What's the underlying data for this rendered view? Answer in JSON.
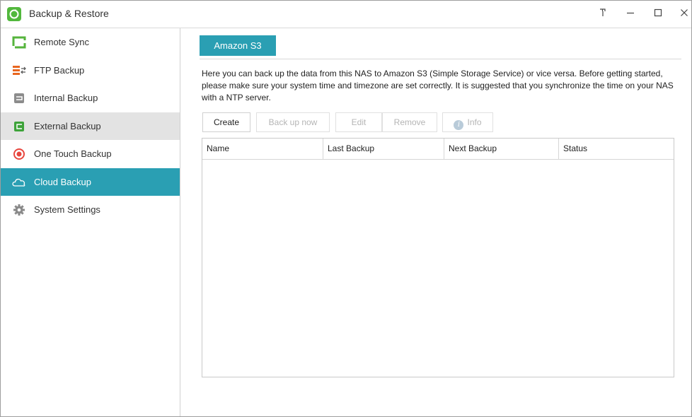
{
  "window": {
    "title": "Backup & Restore",
    "controls": {
      "pin": "ꟼ",
      "minimize": "—",
      "maximize": "☐",
      "close": "✕"
    }
  },
  "sidebar": {
    "items": [
      {
        "label": "Remote Sync",
        "icon": "remote-sync-icon"
      },
      {
        "label": "FTP Backup",
        "icon": "ftp-backup-icon"
      },
      {
        "label": "Internal Backup",
        "icon": "internal-backup-icon"
      },
      {
        "label": "External Backup",
        "icon": "external-backup-icon",
        "state": "hover"
      },
      {
        "label": "One Touch Backup",
        "icon": "one-touch-backup-icon"
      },
      {
        "label": "Cloud Backup",
        "icon": "cloud-icon",
        "state": "selected"
      },
      {
        "label": "System Settings",
        "icon": "gear-icon"
      }
    ]
  },
  "main": {
    "tab_label": "Amazon S3",
    "description": "Here you can back up the data from this NAS to Amazon S3 (Simple Storage Service) or vice versa. Before getting started, please make sure your system time and timezone are set correctly. It is suggested that you synchronize the time on your NAS with a NTP server.",
    "toolbar": {
      "create": "Create",
      "back_up_now": "Back up now",
      "edit": "Edit",
      "remove": "Remove",
      "info": "Info"
    },
    "table": {
      "columns": [
        "Name",
        "Last Backup",
        "Next Backup",
        "Status"
      ],
      "rows": []
    }
  },
  "colors": {
    "accent": "#2a9fb3",
    "app_icon": "#52b83d",
    "hover": "#e3e3e3"
  }
}
